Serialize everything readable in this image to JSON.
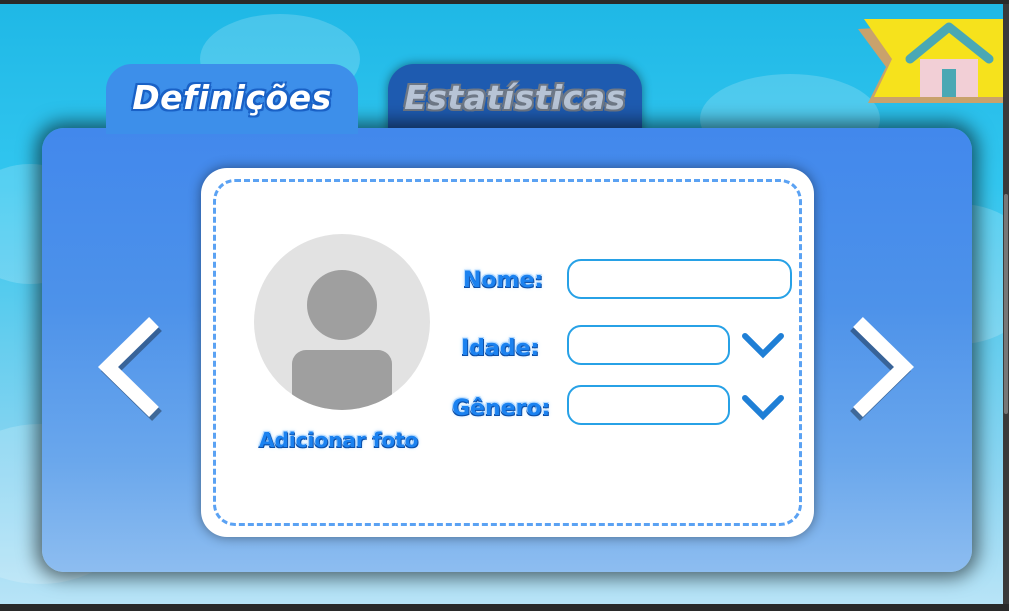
{
  "tabs": {
    "settings_label": "Definições",
    "stats_label": "Estatísticas"
  },
  "profile": {
    "add_photo_label": "Adicionar foto",
    "name_label": "Nome:",
    "name_value": "",
    "age_label": "Idade:",
    "age_value": "",
    "gender_label": "Gênero:",
    "gender_value": ""
  },
  "icons": {
    "prev": "chevron-left-icon",
    "next": "chevron-right-icon",
    "home": "home-icon",
    "dropdown": "chevron-down-icon",
    "avatar": "user-placeholder-icon"
  },
  "colors": {
    "accent": "#3d8fea",
    "label": "#1b82f0",
    "field_border": "#27a1e6",
    "ribbon": "#f6e21c",
    "house_roof": "#4aa8b4",
    "house_wall": "#f2cfd6"
  }
}
